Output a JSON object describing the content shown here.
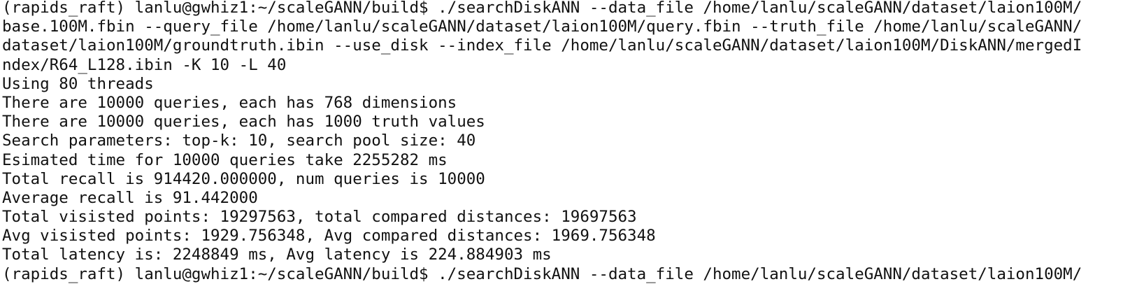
{
  "terminal": {
    "lines": [
      "(rapids_raft) lanlu@gwhiz1:~/scaleGANN/build$ ./searchDiskANN --data_file /home/lanlu/scaleGANN/dataset/laion100M/",
      "base.100M.fbin --query_file /home/lanlu/scaleGANN/dataset/laion100M/query.fbin --truth_file /home/lanlu/scaleGANN/",
      "dataset/laion100M/groundtruth.ibin --use_disk --index_file /home/lanlu/scaleGANN/dataset/laion100M/DiskANN/mergedI",
      "ndex/R64_L128.ibin -K 10 -L 40",
      "Using 80 threads",
      "There are 10000 queries, each has 768 dimensions",
      "There are 10000 queries, each has 1000 truth values",
      "Search parameters: top-k: 10, search pool size: 40",
      "Esimated time for 10000 queries take 2255282 ms",
      "Total recall is 914420.000000, num queries is 10000",
      "Average recall is 91.442000",
      "Total visisted points: 19297563, total compared distances: 19697563",
      "Avg visisted points: 1929.756348, Avg compared distances: 1969.756348",
      "Total latency is: 2248849 ms, Avg latency is 224.884903 ms",
      "(rapids_raft) lanlu@gwhiz1:~/scaleGANN/build$ ./searchDiskANN --data_file /home/lanlu/scaleGANN/dataset/laion100M/"
    ]
  }
}
